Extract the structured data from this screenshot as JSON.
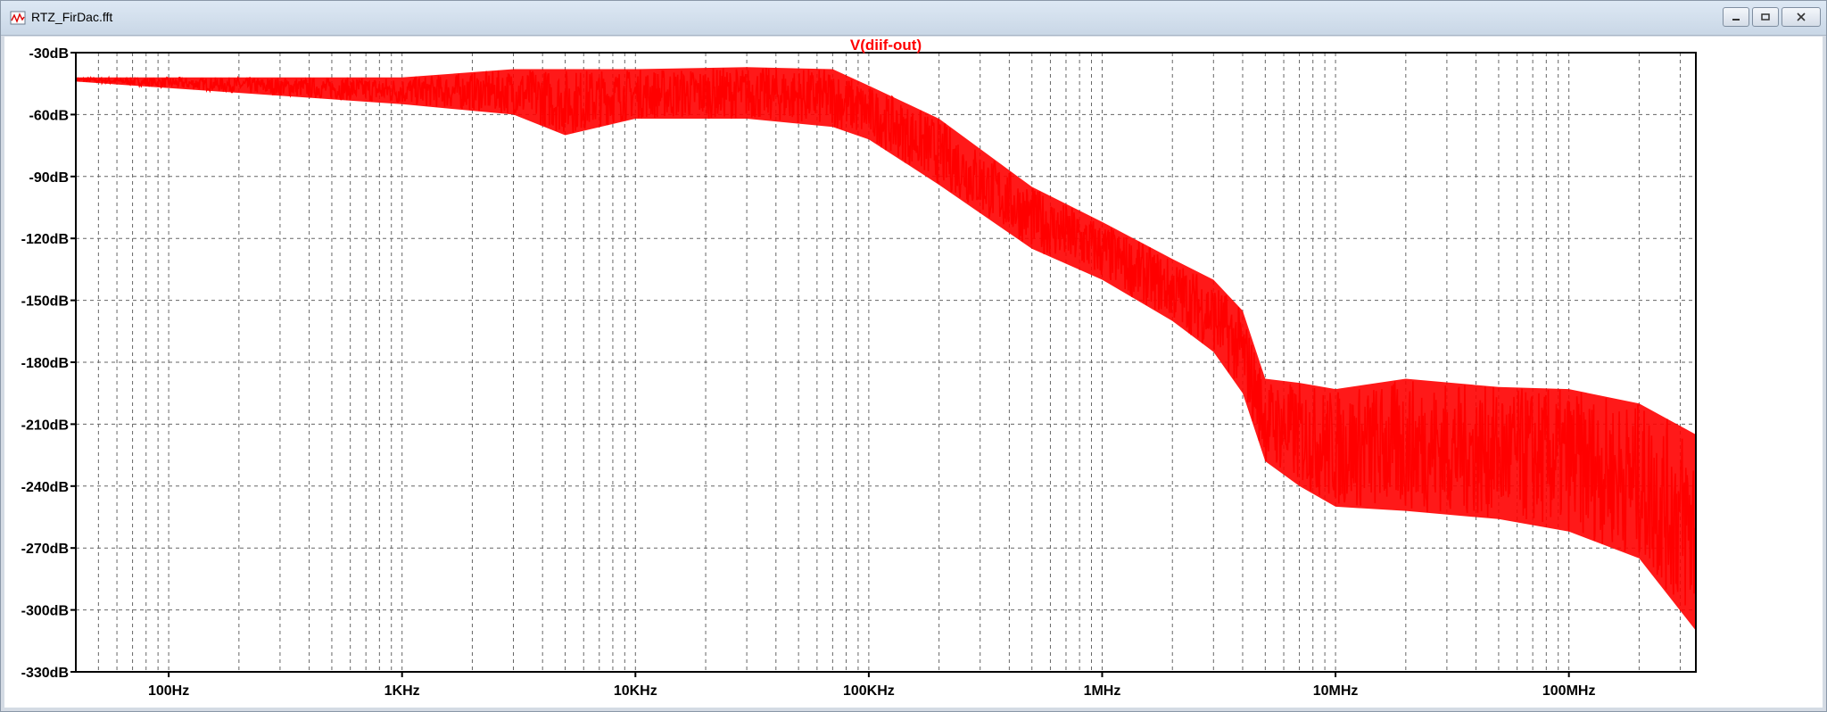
{
  "window": {
    "title": "RTZ_FirDac.fft",
    "buttons": {
      "minimize": "minimize-icon",
      "restore": "restore-icon",
      "close": "close-icon"
    }
  },
  "chart_data": {
    "type": "line",
    "title": "V(diif-out)",
    "xscale": "log",
    "xlim": [
      40,
      350000000
    ],
    "ylim": [
      -330,
      -30
    ],
    "xticks": [
      {
        "value": 100,
        "label": "100Hz"
      },
      {
        "value": 1000,
        "label": "1KHz"
      },
      {
        "value": 10000,
        "label": "10KHz"
      },
      {
        "value": 100000,
        "label": "100KHz"
      },
      {
        "value": 1000000,
        "label": "1MHz"
      },
      {
        "value": 10000000,
        "label": "10MHz"
      },
      {
        "value": 100000000,
        "label": "100MHz"
      }
    ],
    "yticks": [
      {
        "value": -30,
        "label": "-30dB"
      },
      {
        "value": -60,
        "label": "-60dB"
      },
      {
        "value": -90,
        "label": "-90dB"
      },
      {
        "value": -120,
        "label": "-120dB"
      },
      {
        "value": -150,
        "label": "-150dB"
      },
      {
        "value": -180,
        "label": "-180dB"
      },
      {
        "value": -210,
        "label": "-210dB"
      },
      {
        "value": -240,
        "label": "-240dB"
      },
      {
        "value": -270,
        "label": "-270dB"
      },
      {
        "value": -300,
        "label": "-300dB"
      },
      {
        "value": -330,
        "label": "-330dB"
      }
    ],
    "grid": true,
    "series": [
      {
        "name": "V(diif-out)",
        "color": "#ff0000",
        "points": [
          [
            40,
            -43
          ],
          [
            60,
            -44
          ],
          [
            90,
            -46
          ],
          [
            130,
            -52
          ],
          [
            200,
            -48
          ],
          [
            280,
            -52
          ],
          [
            400,
            -47
          ],
          [
            600,
            -49
          ],
          [
            800,
            -46
          ],
          [
            1000,
            -45
          ],
          [
            1500,
            -42
          ],
          [
            2000,
            -45
          ],
          [
            3000,
            -43
          ],
          [
            5000,
            -44
          ],
          [
            10000,
            -43
          ],
          [
            20000,
            -42
          ],
          [
            30000,
            -41
          ],
          [
            50000,
            -41
          ],
          [
            70000,
            -42
          ],
          [
            90000,
            -48
          ],
          [
            100000,
            -53
          ],
          [
            150000,
            -65
          ],
          [
            200000,
            -76
          ],
          [
            300000,
            -92
          ],
          [
            500000,
            -108
          ],
          [
            700000,
            -117
          ],
          [
            1000000,
            -126
          ],
          [
            1500000,
            -136
          ],
          [
            2000000,
            -145
          ],
          [
            3000000,
            -160
          ],
          [
            4000000,
            -178
          ],
          [
            5000000,
            -208
          ],
          [
            7000000,
            -205
          ],
          [
            10000000,
            -212
          ],
          [
            20000000,
            -214
          ],
          [
            50000000,
            -218
          ],
          [
            100000000,
            -222
          ],
          [
            200000000,
            -240
          ],
          [
            350000000,
            -265
          ]
        ],
        "envelope": [
          [
            40,
            -42,
            -44
          ],
          [
            1000,
            -42,
            -55
          ],
          [
            3000,
            -38,
            -60
          ],
          [
            5000,
            -38,
            -70
          ],
          [
            10000,
            -38,
            -62
          ],
          [
            30000,
            -37,
            -62
          ],
          [
            70000,
            -38,
            -66
          ],
          [
            100000,
            -46,
            -72
          ],
          [
            200000,
            -62,
            -94
          ],
          [
            500000,
            -95,
            -125
          ],
          [
            1000000,
            -112,
            -140
          ],
          [
            2000000,
            -130,
            -160
          ],
          [
            3000000,
            -140,
            -175
          ],
          [
            4000000,
            -155,
            -195
          ],
          [
            5000000,
            -188,
            -228
          ],
          [
            7000000,
            -190,
            -240
          ],
          [
            10000000,
            -193,
            -250
          ],
          [
            20000000,
            -188,
            -252
          ],
          [
            50000000,
            -192,
            -256
          ],
          [
            100000000,
            -193,
            -262
          ],
          [
            200000000,
            -200,
            -275
          ],
          [
            350000000,
            -215,
            -310
          ]
        ]
      }
    ]
  }
}
